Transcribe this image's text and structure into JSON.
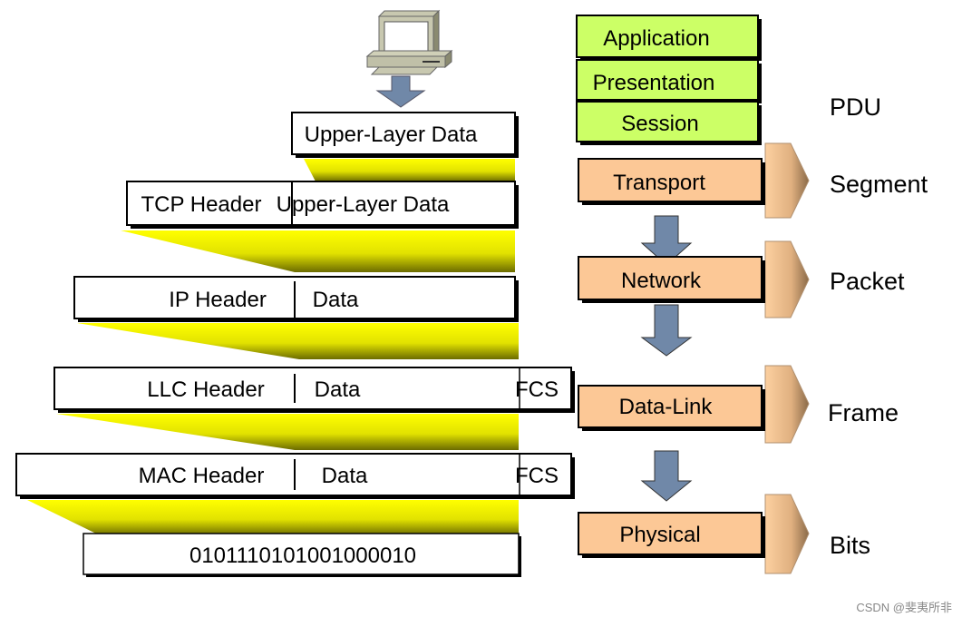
{
  "left": {
    "upper": {
      "data": "Upper-Layer Data"
    },
    "tcp": {
      "header": "TCP Header",
      "data": "Upper-Layer Data"
    },
    "ip": {
      "header": "IP Header",
      "data": "Data"
    },
    "llc": {
      "header": "LLC Header",
      "data": "Data",
      "trailer": "FCS"
    },
    "mac": {
      "header": "MAC Header",
      "data": "Data",
      "trailer": "FCS"
    },
    "bits": {
      "value": "0101110101001000010"
    }
  },
  "layers": {
    "application": "Application",
    "presentation": "Presentation",
    "session": "Session",
    "transport": "Transport",
    "network": "Network",
    "datalink": "Data-Link",
    "physical": "Physical"
  },
  "pdu": {
    "title": "PDU",
    "segment": "Segment",
    "packet": "Packet",
    "frame": "Frame",
    "bits": "Bits"
  },
  "watermark": "CSDN @斐夷所非",
  "colors": {
    "upper_layers": "#ccff66",
    "lower_layers": "#fcc896",
    "arrow": "#7088a8",
    "shadow": "#e6e600"
  }
}
